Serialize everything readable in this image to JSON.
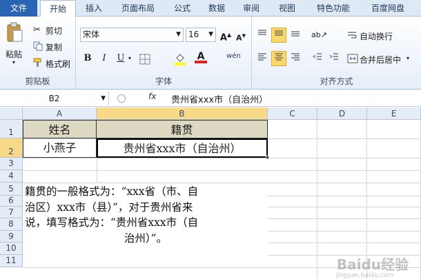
{
  "tabs": [
    "文件",
    "开始",
    "插入",
    "页面布局",
    "公式",
    "数据",
    "审阅",
    "视图",
    "特色功能",
    "百度网盘"
  ],
  "clipboard": {
    "paste": "粘贴",
    "cut": "剪切",
    "copy": "复制",
    "format_painter": "格式刷",
    "label": "剪贴板"
  },
  "font": {
    "name": "宋体",
    "size": "16",
    "bold": "B",
    "italic": "I",
    "underline": "U",
    "label": "字体"
  },
  "alignment": {
    "wrap": "自动换行",
    "merge": "合并后居中",
    "label": "对齐方式"
  },
  "formula_bar": {
    "name_box": "B2",
    "fx": "fx",
    "value": "贵州省xxx市（自治州）"
  },
  "columns": [
    "A",
    "B",
    "C",
    "D",
    "E"
  ],
  "rows": [
    "1",
    "2",
    "3",
    "4",
    "5",
    "6",
    "7",
    "8",
    "9",
    "10",
    "11"
  ],
  "cells": {
    "A1": "姓名",
    "B1": "籍贯",
    "A2": "小燕子",
    "B2": "贵州省xxx市（自治州）"
  },
  "note": {
    "line1": "籍贯的一般格式为：“xxx省（市、自",
    "line2": "治区）xxx市（县）”，对于贵州省来",
    "line3": "说，填写格式为：“贵州省xxx市（自",
    "line4": "治州）”。"
  },
  "colors": {
    "header_fill": "#ddd9c3",
    "selection": "#000000",
    "accent": "#fbd86e"
  },
  "watermark": {
    "logo": "Baidu经验",
    "url": "jingyan.baidu.com"
  }
}
